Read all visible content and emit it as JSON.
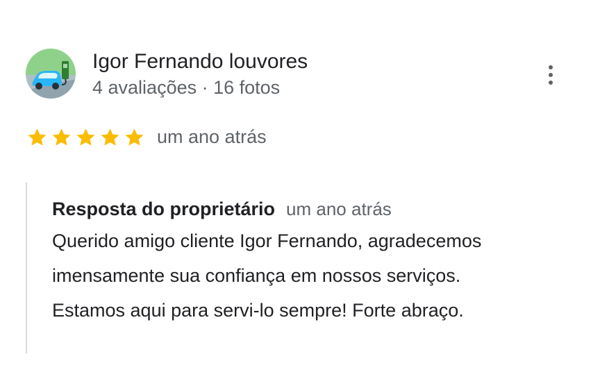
{
  "reviewer": {
    "name": "Igor Fernando louvores",
    "meta": "4 avaliações · 16 fotos",
    "avatar_icon": "car-charging-avatar"
  },
  "review": {
    "rating": 5,
    "rating_max": 5,
    "date": "um ano atrás",
    "star_color": "#fbbc04"
  },
  "owner_reply": {
    "title": "Resposta do proprietário",
    "date": "um ano atrás",
    "lines": [
      "Querido amigo cliente Igor Fernando, agradecemos",
      "imensamente sua confiança em nossos serviços.",
      "Estamos aqui para servi-lo sempre! Forte abraço."
    ]
  },
  "menu_icon": "more-vert-icon"
}
